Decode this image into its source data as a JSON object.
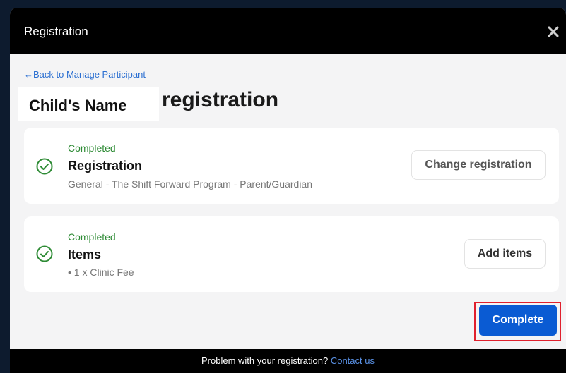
{
  "modal": {
    "title": "Registration",
    "close_icon": "close-icon",
    "back_link": "←Back to Manage Participant",
    "name_placeholder": "Child's Name",
    "heading": "registration"
  },
  "cards": {
    "registration": {
      "status": "Completed",
      "title": "Registration",
      "detail": "General - The Shift Forward Program - Parent/Guardian",
      "button": "Change registration",
      "icon": "check-circle-icon"
    },
    "items": {
      "status": "Completed",
      "title": "Items",
      "detail": "• 1 x Clinic Fee",
      "button": "Add items",
      "icon": "check-circle-icon"
    }
  },
  "actions": {
    "complete": "Complete"
  },
  "footer": {
    "text": "Problem with your registration?",
    "link": "Contact us"
  },
  "colors": {
    "accent": "#0a5bd3",
    "success": "#2e8b35",
    "highlight": "#e0202d",
    "link": "#2b6fd1"
  }
}
